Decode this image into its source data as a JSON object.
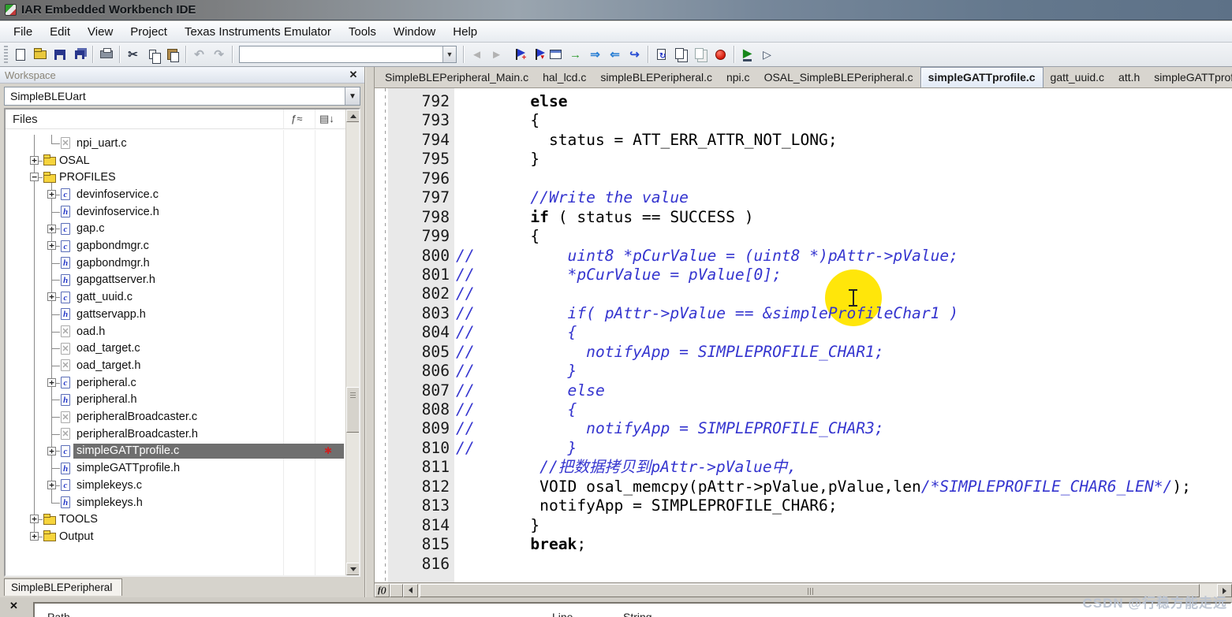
{
  "window": {
    "title": "IAR Embedded Workbench IDE"
  },
  "menu": {
    "items": [
      "File",
      "Edit",
      "View",
      "Project",
      "Texas Instruments Emulator",
      "Tools",
      "Window",
      "Help"
    ]
  },
  "toolbar": {
    "combo_value": "",
    "buttons": [
      {
        "name": "new-file-button",
        "icon": "new-file-icon",
        "kind": "new"
      },
      {
        "name": "open-file-button",
        "icon": "open-folder-icon",
        "kind": "open"
      },
      {
        "name": "save-button",
        "icon": "save-floppy-icon",
        "kind": "save"
      },
      {
        "name": "save-all-button",
        "icon": "save-all-icon",
        "kind": "saveall"
      },
      {
        "sep": true
      },
      {
        "name": "print-button",
        "icon": "printer-icon",
        "kind": "print"
      },
      {
        "sep": true
      },
      {
        "name": "cut-button",
        "icon": "scissors-icon",
        "kind": "glyph",
        "glyph": "✂",
        "color": "#30394a"
      },
      {
        "name": "copy-button",
        "icon": "copy-icon",
        "kind": "copy"
      },
      {
        "name": "paste-button",
        "icon": "paste-clipboard-icon",
        "kind": "paste"
      },
      {
        "sep": true
      },
      {
        "name": "undo-button",
        "icon": "undo-arrow-icon",
        "kind": "glyph",
        "glyph": "↶",
        "color": "#aab0b8"
      },
      {
        "name": "redo-button",
        "icon": "redo-arrow-icon",
        "kind": "glyph",
        "glyph": "↷",
        "color": "#aab0b8"
      },
      {
        "sep": true
      },
      {
        "combo": true
      },
      {
        "sep": true
      },
      {
        "name": "find-previous-button",
        "icon": "nav-previous-icon",
        "kind": "glyph",
        "glyph": "◄",
        "color": "#b2b2b2"
      },
      {
        "name": "find-next-button",
        "icon": "nav-next-icon",
        "kind": "glyph",
        "glyph": "►",
        "color": "#b2b2b2"
      },
      {
        "name": "toggle-bookmark-button",
        "icon": "bookmark-add-icon",
        "kind": "flagplus"
      },
      {
        "name": "next-bookmark-button",
        "icon": "bookmark-next-icon",
        "kind": "flagdown"
      },
      {
        "name": "goto-window-button",
        "icon": "window-icon",
        "kind": "window"
      },
      {
        "name": "go-button",
        "icon": "go-arrow-icon",
        "kind": "glyph",
        "glyph": "→",
        "color": "#2c9a2c"
      },
      {
        "name": "browse-forward-button",
        "icon": "browse-forward-icon",
        "kind": "glyph",
        "glyph": "⇒",
        "color": "#2a7fd4"
      },
      {
        "name": "browse-back-button",
        "icon": "browse-back-icon",
        "kind": "glyph",
        "glyph": "⇐",
        "color": "#2a7fd4"
      },
      {
        "name": "open-header-source-button",
        "icon": "open-source-icon",
        "kind": "glyph",
        "glyph": "↪",
        "color": "#2a4fd4"
      },
      {
        "sep": true
      },
      {
        "name": "compile-button",
        "icon": "compile-icon",
        "kind": "compile"
      },
      {
        "name": "make-button",
        "icon": "make-icon",
        "kind": "make"
      },
      {
        "name": "stop-build-disabled-button",
        "icon": "stop-build-disabled-icon",
        "kind": "makegray"
      },
      {
        "name": "stop-build-button",
        "icon": "stop-build-icon",
        "kind": "stop"
      },
      {
        "sep": true
      },
      {
        "name": "download-debug-button",
        "icon": "debug-icon",
        "kind": "debug"
      },
      {
        "name": "debug-without-download-button",
        "icon": "debug-no-download-icon",
        "kind": "debugnd"
      }
    ]
  },
  "workspace": {
    "title": "Workspace",
    "close_glyph": "✕",
    "project_select": "SimpleBLEUart",
    "files_header": "Files",
    "bottom_tab": "SimpleBLEPeripheral",
    "tree": [
      {
        "label": "npi_uart.c",
        "level": 1,
        "icon": "x",
        "expand": null
      },
      {
        "label": "OSAL",
        "level": 0,
        "icon": "folder",
        "expand": "+"
      },
      {
        "label": "PROFILES",
        "level": 0,
        "icon": "folder",
        "expand": "-"
      },
      {
        "label": "devinfoservice.c",
        "level": 1,
        "icon": "c",
        "expand": "+"
      },
      {
        "label": "devinfoservice.h",
        "level": 1,
        "icon": "h",
        "expand": null
      },
      {
        "label": "gap.c",
        "level": 1,
        "icon": "c",
        "expand": "+"
      },
      {
        "label": "gapbondmgr.c",
        "level": 1,
        "icon": "c",
        "expand": "+"
      },
      {
        "label": "gapbondmgr.h",
        "level": 1,
        "icon": "h",
        "expand": null
      },
      {
        "label": "gapgattserver.h",
        "level": 1,
        "icon": "h",
        "expand": null
      },
      {
        "label": "gatt_uuid.c",
        "level": 1,
        "icon": "c",
        "expand": "+"
      },
      {
        "label": "gattservapp.h",
        "level": 1,
        "icon": "h",
        "expand": null
      },
      {
        "label": "oad.h",
        "level": 1,
        "icon": "x",
        "expand": null
      },
      {
        "label": "oad_target.c",
        "level": 1,
        "icon": "x",
        "expand": null
      },
      {
        "label": "oad_target.h",
        "level": 1,
        "icon": "x",
        "expand": null
      },
      {
        "label": "peripheral.c",
        "level": 1,
        "icon": "c",
        "expand": "+"
      },
      {
        "label": "peripheral.h",
        "level": 1,
        "icon": "h",
        "expand": null
      },
      {
        "label": "peripheralBroadcaster.c",
        "level": 1,
        "icon": "x",
        "expand": null
      },
      {
        "label": "peripheralBroadcaster.h",
        "level": 1,
        "icon": "x",
        "expand": null
      },
      {
        "label": "simpleGATTprofile.c",
        "level": 1,
        "icon": "c",
        "expand": "+",
        "selected": true,
        "marker": "✱"
      },
      {
        "label": "simpleGATTprofile.h",
        "level": 1,
        "icon": "h",
        "expand": null
      },
      {
        "label": "simplekeys.c",
        "level": 1,
        "icon": "c",
        "expand": "+"
      },
      {
        "label": "simplekeys.h",
        "level": 1,
        "icon": "h",
        "expand": null
      },
      {
        "label": "TOOLS",
        "level": 0,
        "icon": "folder",
        "expand": "+"
      },
      {
        "label": "Output",
        "level": 0,
        "icon": "folder",
        "expand": "+"
      }
    ]
  },
  "editor": {
    "tabs": [
      {
        "label": "SimpleBLEPeripheral_Main.c",
        "active": false
      },
      {
        "label": "hal_lcd.c",
        "active": false
      },
      {
        "label": "simpleBLEPeripheral.c",
        "active": false
      },
      {
        "label": "npi.c",
        "active": false
      },
      {
        "label": "OSAL_SimpleBLEPeripheral.c",
        "active": false
      },
      {
        "label": "simpleGATTprofile.c",
        "active": true
      },
      {
        "label": "gatt_uuid.c",
        "active": false
      },
      {
        "label": "att.h",
        "active": false
      },
      {
        "label": "simpleGATTprofile.h",
        "active": false
      }
    ],
    "function_button": "f()",
    "colors": {
      "comment": "#3535cf",
      "keyword": "#000000",
      "plain": "#000000",
      "highlight": "#ffe60a"
    },
    "lines": [
      {
        "n": "792",
        "segs": [
          [
            "p",
            "        "
          ],
          [
            "k",
            "else"
          ]
        ]
      },
      {
        "n": "793",
        "segs": [
          [
            "p",
            "        {"
          ]
        ]
      },
      {
        "n": "794",
        "segs": [
          [
            "p",
            "          status = ATT_ERR_ATTR_NOT_LONG;"
          ]
        ]
      },
      {
        "n": "795",
        "segs": [
          [
            "p",
            "        }"
          ]
        ]
      },
      {
        "n": "796",
        "segs": []
      },
      {
        "n": "797",
        "segs": [
          [
            "c",
            "        //Write the value"
          ]
        ]
      },
      {
        "n": "798",
        "segs": [
          [
            "p",
            "        "
          ],
          [
            "k",
            "if"
          ],
          [
            "p",
            " ( status == SUCCESS )"
          ]
        ]
      },
      {
        "n": "799",
        "segs": [
          [
            "p",
            "        {"
          ]
        ]
      },
      {
        "n": "800",
        "segs": [
          [
            "c",
            "//          uint8 *pCurValue = (uint8 *)pAttr->pValue;"
          ]
        ]
      },
      {
        "n": "801",
        "segs": [
          [
            "c",
            "//          *pCurValue = pValue[0];"
          ]
        ]
      },
      {
        "n": "802",
        "segs": [
          [
            "c",
            "//"
          ]
        ]
      },
      {
        "n": "803",
        "segs": [
          [
            "c",
            "//          if( pAttr->pValue == &simpleProfileChar1 )"
          ]
        ]
      },
      {
        "n": "804",
        "segs": [
          [
            "c",
            "//          {"
          ]
        ]
      },
      {
        "n": "805",
        "segs": [
          [
            "c",
            "//            notifyApp = SIMPLEPROFILE_CHAR1;"
          ]
        ]
      },
      {
        "n": "806",
        "segs": [
          [
            "c",
            "//          }"
          ]
        ]
      },
      {
        "n": "807",
        "segs": [
          [
            "c",
            "//          else"
          ]
        ]
      },
      {
        "n": "808",
        "segs": [
          [
            "c",
            "//          {"
          ]
        ]
      },
      {
        "n": "809",
        "segs": [
          [
            "c",
            "//            notifyApp = SIMPLEPROFILE_CHAR3;"
          ]
        ]
      },
      {
        "n": "810",
        "segs": [
          [
            "c",
            "//          }"
          ]
        ]
      },
      {
        "n": "811",
        "segs": [
          [
            "c",
            "         //把数据拷贝到pAttr->pValue中,"
          ]
        ]
      },
      {
        "n": "812",
        "segs": [
          [
            "p",
            "         VOID osal_memcpy(pAttr->pValue,pValue,len"
          ],
          [
            "c",
            "/*SIMPLEPROFILE_CHAR6_LEN*/"
          ],
          [
            "p",
            ");"
          ]
        ]
      },
      {
        "n": "813",
        "segs": [
          [
            "p",
            "         notifyApp = SIMPLEPROFILE_CHAR6;"
          ]
        ]
      },
      {
        "n": "814",
        "segs": [
          [
            "p",
            "        }"
          ]
        ]
      },
      {
        "n": "815",
        "segs": [
          [
            "p",
            "        "
          ],
          [
            "k",
            "break"
          ],
          [
            "p",
            ";"
          ]
        ]
      },
      {
        "n": "816",
        "segs": []
      }
    ]
  },
  "bottom_panel": {
    "close_glyph": "✕",
    "headers": {
      "path": "Path",
      "line": "Line",
      "string": "String"
    }
  },
  "watermark": "CSDN @行稳方能走远"
}
